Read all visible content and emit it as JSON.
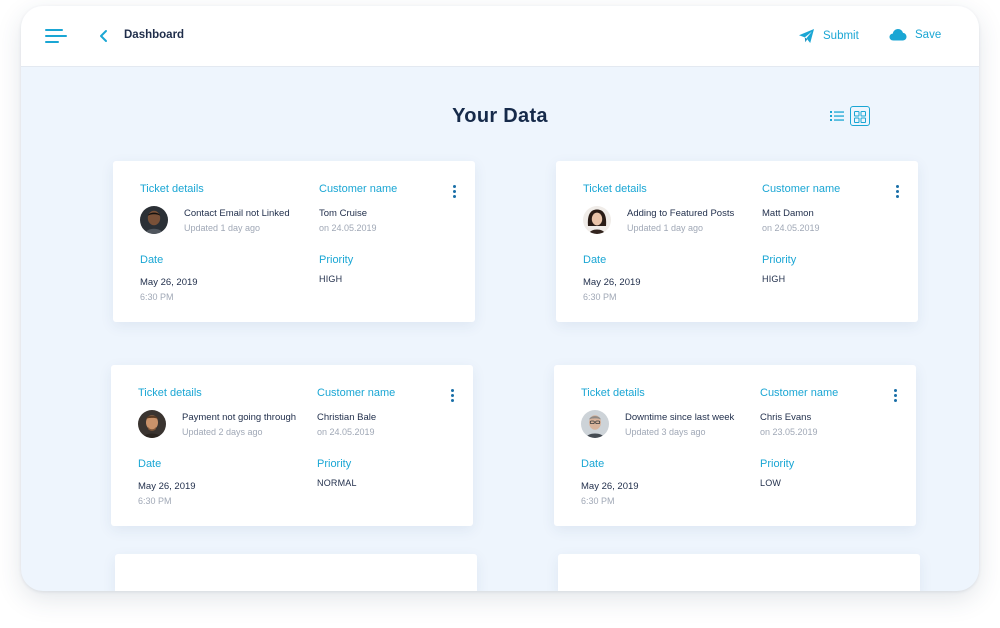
{
  "header": {
    "breadcrumb": "Dashboard",
    "actions": {
      "submit_label": "Submit",
      "save_label": "Save"
    },
    "icons": {
      "menu": "hamburger-menu-icon",
      "back": "chevron-left-icon",
      "submit": "paper-plane-icon",
      "save": "cloud-icon"
    }
  },
  "page": {
    "title": "Your Data",
    "view_options": [
      "list-view-icon",
      "grid-view-icon"
    ],
    "active_view": "grid"
  },
  "labels": {
    "ticket_details": "Ticket details",
    "customer_name": "Customer name",
    "date": "Date",
    "priority": "Priority"
  },
  "tickets": [
    {
      "subject": "Contact Email not Linked",
      "updated": "Updated 1 day ago",
      "customer": "Tom Cruise",
      "customer_date": "on 24.05.2019",
      "date": "May 26, 2019",
      "time": "6:30 PM",
      "priority": "HIGH"
    },
    {
      "subject": "Adding to Featured Posts",
      "updated": "Updated 1 day ago",
      "customer": "Matt Damon",
      "customer_date": "on 24.05.2019",
      "date": "May 26, 2019",
      "time": "6:30 PM",
      "priority": "HIGH"
    },
    {
      "subject": "Payment not going through",
      "updated": "Updated 2 days ago",
      "customer": "Christian Bale",
      "customer_date": "on 24.05.2019",
      "date": "May 26, 2019",
      "time": "6:30 PM",
      "priority": "NORMAL"
    },
    {
      "subject": "Downtime since last week",
      "updated": "Updated 3 days ago",
      "customer": "Chris Evans",
      "customer_date": "on 23.05.2019",
      "date": "May 26, 2019",
      "time": "6:30 PM",
      "priority": "LOW"
    }
  ],
  "colors": {
    "accent": "#1aa6d4",
    "title": "#162a4a",
    "background": "#eef5fd",
    "muted": "#a0a8b6"
  }
}
